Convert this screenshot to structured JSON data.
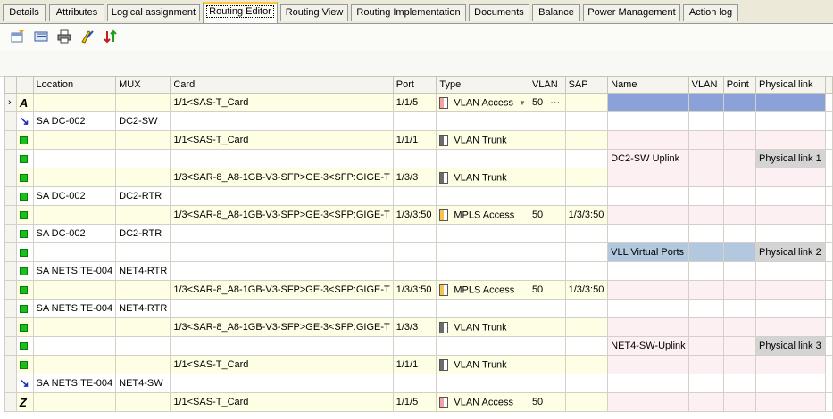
{
  "tabs": [
    {
      "label": "Details"
    },
    {
      "label": "Attributes"
    },
    {
      "label": "Logical assignment"
    },
    {
      "label": "Routing Editor"
    },
    {
      "label": "Routing View"
    },
    {
      "label": "Routing Implementation"
    },
    {
      "label": "Documents"
    },
    {
      "label": "Balance"
    },
    {
      "label": "Power Management"
    },
    {
      "label": "Action log"
    }
  ],
  "active_tab": "Routing Editor",
  "toolbar": {
    "icons": [
      "edit-routing-icon",
      "route-icon",
      "print-icon",
      "validate-icon",
      "sort-icon"
    ]
  },
  "columns": {
    "location": "Location",
    "mux": "MUX",
    "card": "Card",
    "port": "Port",
    "type": "Type",
    "vlan": "VLAN",
    "sap": "SAP",
    "name": "Name",
    "vlan2": "VLAN",
    "point": "Point",
    "plink": "Physical link"
  },
  "colors": {
    "selected_row": "#8ba2d9",
    "link_highlight": "#b2c8de",
    "endpoint_row": "#fefee4",
    "link_pink": "#fdf0f2",
    "status_green": "#19c019"
  },
  "rows": [
    {
      "marker": "A",
      "location": "",
      "mux": "",
      "card": "1/1<SAS-T_Card",
      "port": "1/1/5",
      "type": "VLAN Access",
      "type_icon": "vlan-access-icon",
      "vlan": "50",
      "sap": "",
      "name": "",
      "vlan2": "",
      "point": "",
      "plink": ""
    },
    {
      "marker": "arrow",
      "location": "SA DC-002",
      "mux": "DC2-SW",
      "card": "",
      "port": "",
      "type": "",
      "type_icon": "",
      "vlan": "",
      "sap": "",
      "name": "",
      "vlan2": "",
      "point": "",
      "plink": ""
    },
    {
      "marker": "green",
      "location": "",
      "mux": "",
      "card": "1/1<SAS-T_Card",
      "port": "1/1/1",
      "type": "VLAN Trunk",
      "type_icon": "vlan-trunk-icon",
      "vlan": "",
      "sap": "",
      "name": "",
      "vlan2": "",
      "point": "",
      "plink": ""
    },
    {
      "marker": "green",
      "location": "",
      "mux": "",
      "card": "",
      "port": "",
      "type": "",
      "type_icon": "",
      "vlan": "",
      "sap": "",
      "name": "DC2-SW Uplink",
      "vlan2": "",
      "point": "",
      "plink": "Physical link 1"
    },
    {
      "marker": "green",
      "location": "",
      "mux": "",
      "card": "1/3<SAR-8_A8-1GB-V3-SFP>GE-3<SFP:GIGE-T",
      "port": "1/3/3",
      "type": "VLAN Trunk",
      "type_icon": "vlan-trunk-icon",
      "vlan": "",
      "sap": "",
      "name": "",
      "vlan2": "",
      "point": "",
      "plink": ""
    },
    {
      "marker": "green",
      "location": "SA DC-002",
      "mux": "DC2-RTR",
      "card": "",
      "port": "",
      "type": "",
      "type_icon": "",
      "vlan": "",
      "sap": "",
      "name": "",
      "vlan2": "",
      "point": "",
      "plink": ""
    },
    {
      "marker": "green",
      "location": "",
      "mux": "",
      "card": "1/3<SAR-8_A8-1GB-V3-SFP>GE-3<SFP:GIGE-T",
      "port": "1/3/3:50",
      "type": "MPLS Access",
      "type_icon": "mpls-access-icon",
      "vlan": "50",
      "sap": "1/3/3:50",
      "name": "",
      "vlan2": "",
      "point": "",
      "plink": ""
    },
    {
      "marker": "green",
      "location": "SA DC-002",
      "mux": "DC2-RTR",
      "card": "",
      "port": "",
      "type": "",
      "type_icon": "",
      "vlan": "",
      "sap": "",
      "name": "",
      "vlan2": "",
      "point": "",
      "plink": ""
    },
    {
      "marker": "green",
      "location": "",
      "mux": "",
      "card": "",
      "port": "",
      "type": "",
      "type_icon": "",
      "vlan": "",
      "sap": "",
      "name": "VLL Virtual Ports",
      "vlan2": "",
      "point": "",
      "plink": "Physical link 2"
    },
    {
      "marker": "green",
      "location": "SA NETSITE-004",
      "mux": "NET4-RTR",
      "card": "",
      "port": "",
      "type": "",
      "type_icon": "",
      "vlan": "",
      "sap": "",
      "name": "",
      "vlan2": "",
      "point": "",
      "plink": ""
    },
    {
      "marker": "green",
      "location": "",
      "mux": "",
      "card": "1/3<SAR-8_A8-1GB-V3-SFP>GE-3<SFP:GIGE-T",
      "port": "1/3/3:50",
      "type": "MPLS Access",
      "type_icon": "mpls-access-icon",
      "vlan": "50",
      "sap": "1/3/3:50",
      "name": "",
      "vlan2": "",
      "point": "",
      "plink": ""
    },
    {
      "marker": "green",
      "location": "SA NETSITE-004",
      "mux": "NET4-RTR",
      "card": "",
      "port": "",
      "type": "",
      "type_icon": "",
      "vlan": "",
      "sap": "",
      "name": "",
      "vlan2": "",
      "point": "",
      "plink": ""
    },
    {
      "marker": "green",
      "location": "",
      "mux": "",
      "card": "1/3<SAR-8_A8-1GB-V3-SFP>GE-3<SFP:GIGE-T",
      "port": "1/3/3",
      "type": "VLAN Trunk",
      "type_icon": "vlan-trunk-icon",
      "vlan": "",
      "sap": "",
      "name": "",
      "vlan2": "",
      "point": "",
      "plink": ""
    },
    {
      "marker": "green",
      "location": "",
      "mux": "",
      "card": "",
      "port": "",
      "type": "",
      "type_icon": "",
      "vlan": "",
      "sap": "",
      "name": "NET4-SW-Uplink",
      "vlan2": "",
      "point": "",
      "plink": "Physical link 3"
    },
    {
      "marker": "green",
      "location": "",
      "mux": "",
      "card": "1/1<SAS-T_Card",
      "port": "1/1/1",
      "type": "VLAN Trunk",
      "type_icon": "vlan-trunk-icon",
      "vlan": "",
      "sap": "",
      "name": "",
      "vlan2": "",
      "point": "",
      "plink": ""
    },
    {
      "marker": "arrow",
      "location": "SA NETSITE-004",
      "mux": "NET4-SW",
      "card": "",
      "port": "",
      "type": "",
      "type_icon": "",
      "vlan": "",
      "sap": "",
      "name": "",
      "vlan2": "",
      "point": "",
      "plink": ""
    },
    {
      "marker": "Z",
      "location": "",
      "mux": "",
      "card": "1/1<SAS-T_Card",
      "port": "1/1/5",
      "type": "VLAN Access",
      "type_icon": "vlan-access-icon",
      "vlan": "50",
      "sap": "",
      "name": "",
      "vlan2": "",
      "point": "",
      "plink": ""
    }
  ]
}
